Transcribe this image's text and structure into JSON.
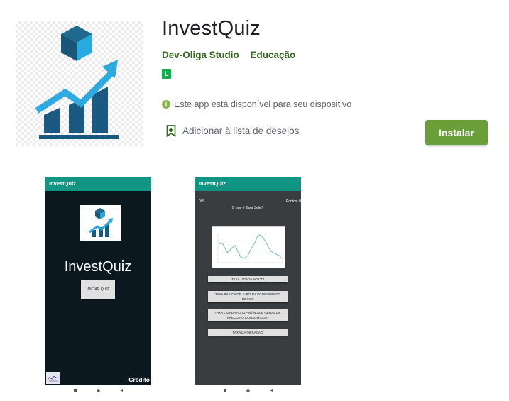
{
  "app": {
    "title": "InvestQuiz",
    "developer": "Dev-Oliga Studio",
    "category": "Educação",
    "content_rating": "L",
    "availability": "Este app está disponível para seu dispositivo",
    "wishlist_label": "Adicionar à lista de desejos",
    "install_label": "Instalar"
  },
  "colors": {
    "install_button": "#689f38",
    "developer_text": "#33691e",
    "rating_badge": "#0bb14a",
    "phone_appbar": "#119482"
  },
  "icons": {
    "app_icon": "cube-growth-chart-icon",
    "availability": "info-circle-icon",
    "wishlist": "bookmark-add-icon"
  },
  "screenshots": [
    {
      "appbar_title": "InvestQuiz",
      "screen_title": "InvestQuiz",
      "start_button": "INICIAR QUIZ",
      "credits": "Crédito"
    },
    {
      "appbar_title": "InvestQuiz",
      "counter": "0/3",
      "points": "Pontos: 0",
      "question": "O que é Taxa Selic?",
      "options": [
        "TAXA LIGADA AO CDI",
        "TAXA BÁSICA DE JURO DA ECONOMIA DO BRASIL",
        "TAXA LIGADA AO IGP-M(ÍNDICE GERAL DE PREÇO AO CONSUMIDOR)",
        "TAXA DA INFLAÇÃO"
      ]
    }
  ]
}
